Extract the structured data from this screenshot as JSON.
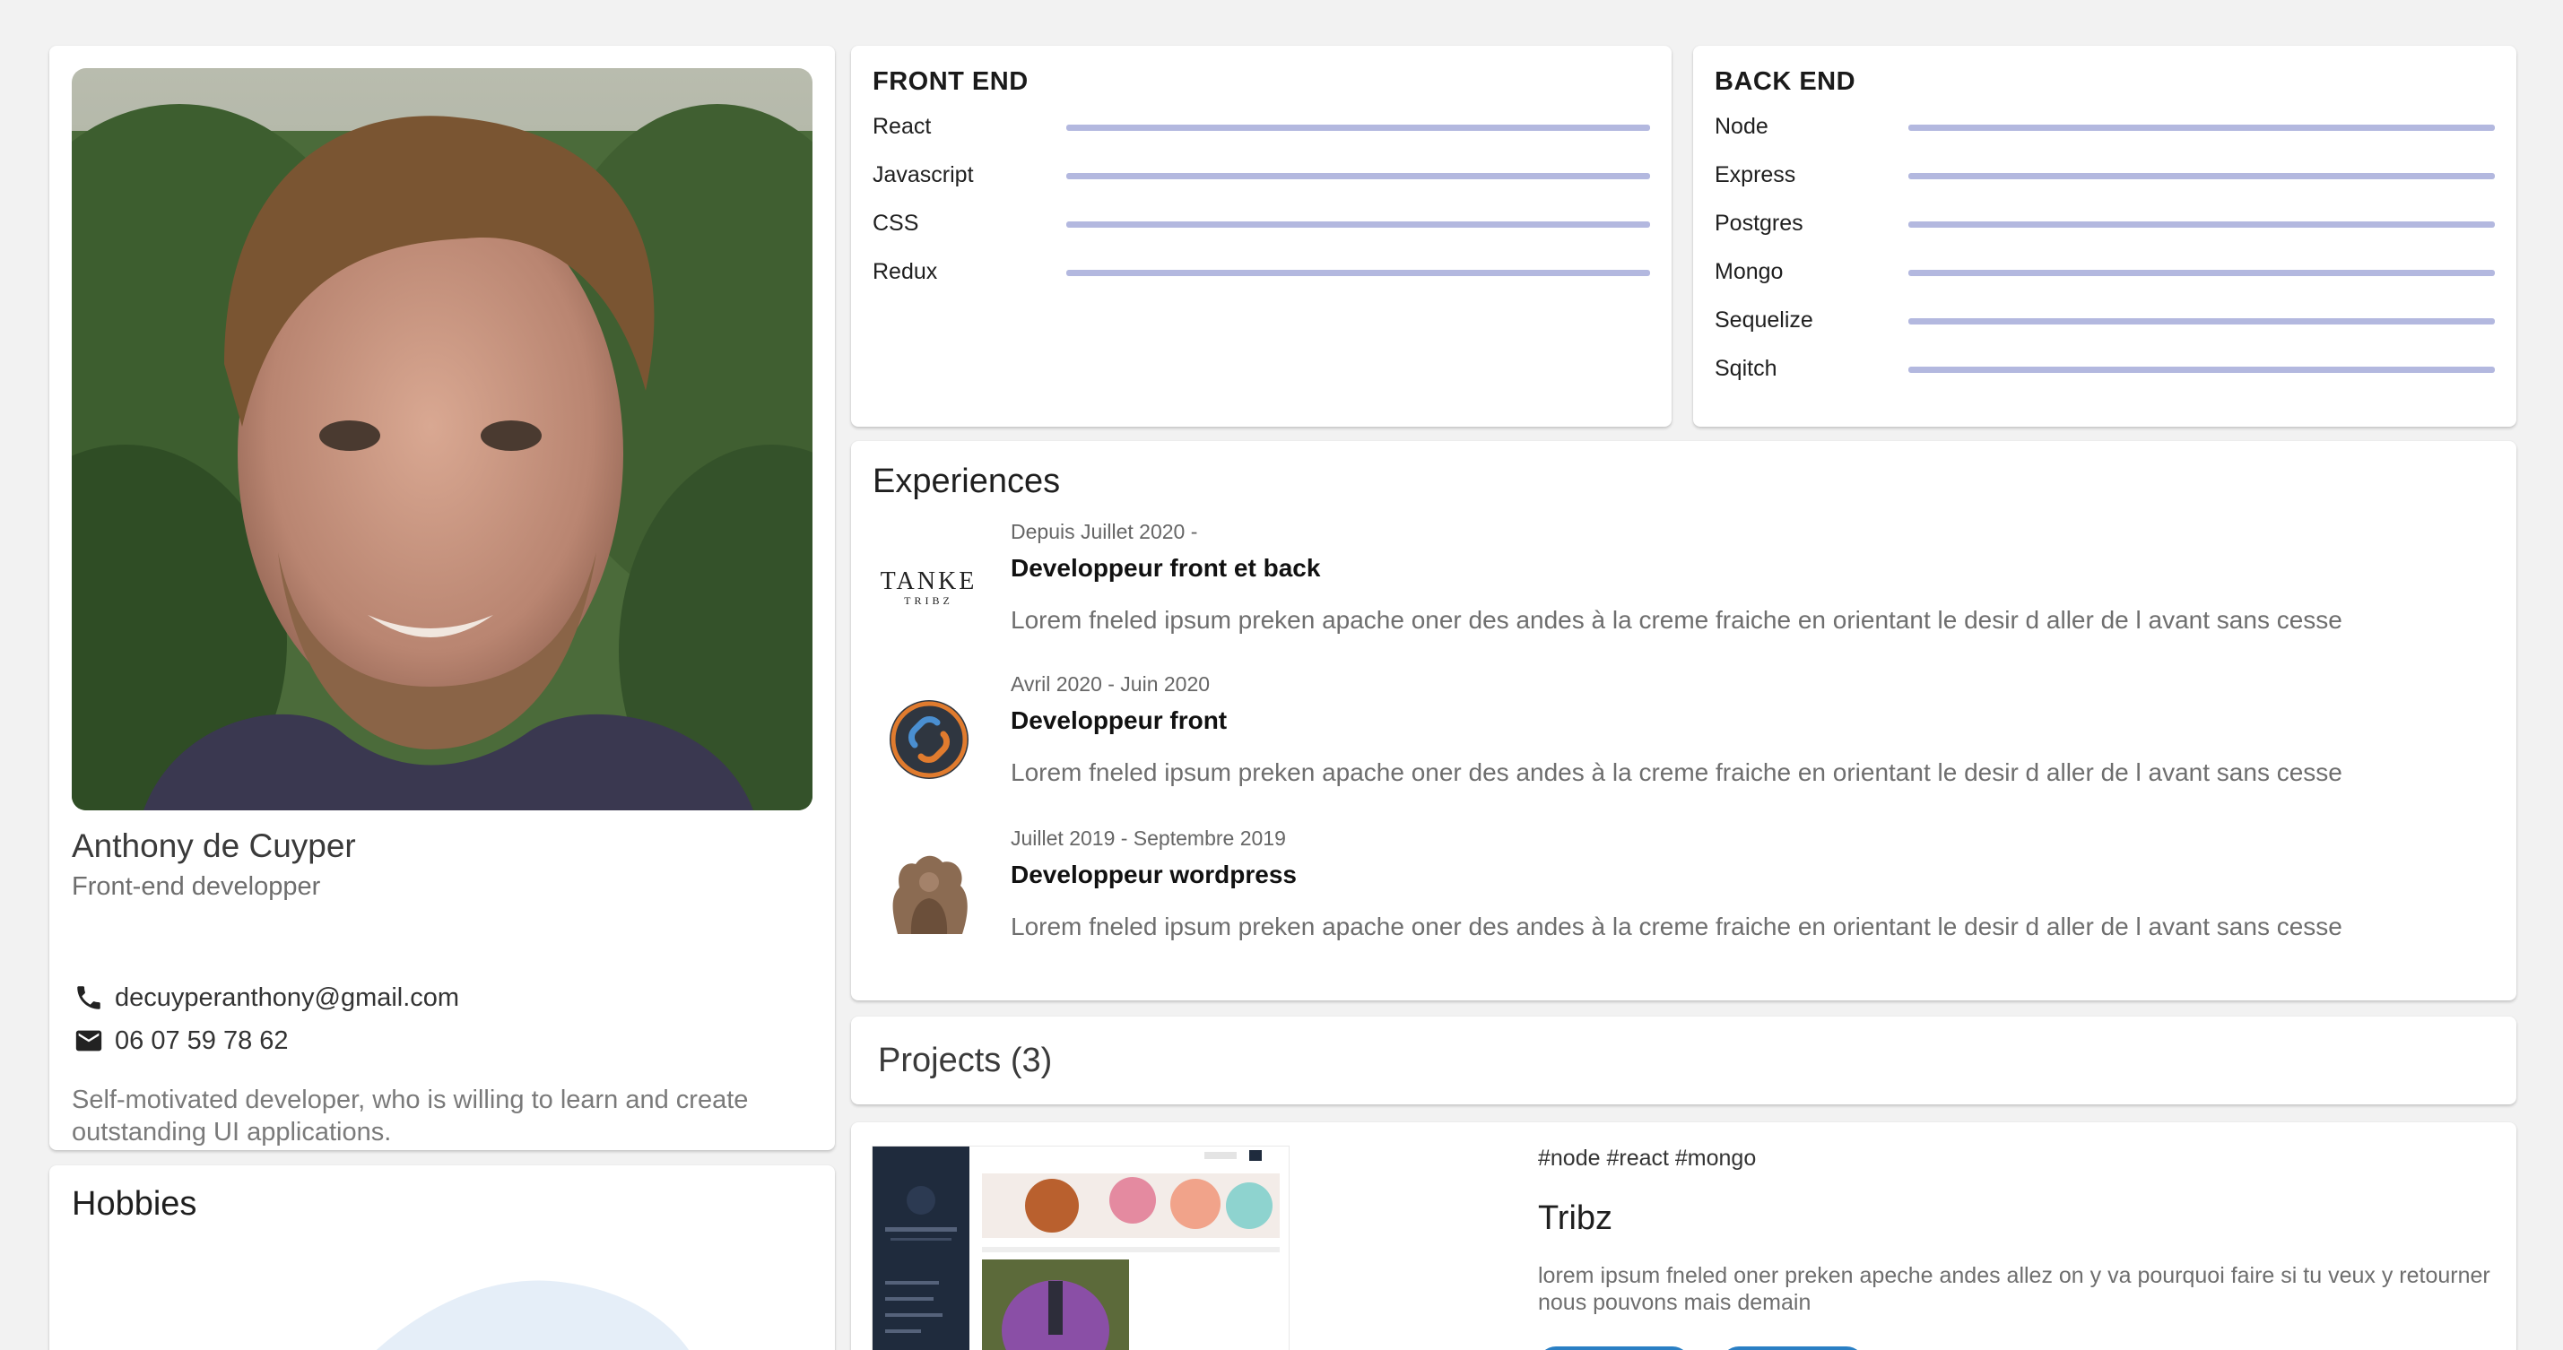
{
  "profile": {
    "name": "Anthony de Cuyper",
    "role": "Front-end developper",
    "email": "decuyperanthony@gmail.com",
    "phone": "06 07 59 78 62",
    "bio": "Self-motivated developer, who is willing to learn and create outstanding UI applications.",
    "email_icon": "phone-icon",
    "phone_icon": "mail-icon"
  },
  "hobbies": {
    "title": "Hobbies"
  },
  "frontend": {
    "title": "FRONT END",
    "skills": [
      {
        "name": "React",
        "level": 1.0
      },
      {
        "name": "Javascript",
        "level": 1.0
      },
      {
        "name": "CSS",
        "level": 1.0
      },
      {
        "name": "Redux",
        "level": 1.0
      }
    ]
  },
  "backend": {
    "title": "BACK END",
    "skills": [
      {
        "name": "Node",
        "level": 1.0
      },
      {
        "name": "Express",
        "level": 1.0
      },
      {
        "name": "Postgres",
        "level": 1.0
      },
      {
        "name": "Mongo",
        "level": 1.0
      },
      {
        "name": "Sequelize",
        "level": 1.0
      },
      {
        "name": "Sqitch",
        "level": 1.0
      }
    ]
  },
  "experiences": {
    "title": "Experiences",
    "items": [
      {
        "date": "Depuis Juillet 2020 -",
        "role": "Developpeur front et back",
        "desc": "Lorem fneled ipsum preken apache oner des andes à la creme fraiche en orientant le desir d aller de l avant sans cesse",
        "logo_text": "TANKE",
        "logo_sub": "TRIBZ"
      },
      {
        "date": "Avril 2020 - Juin 2020",
        "role": "Developpeur front",
        "desc": "Lorem fneled ipsum preken apache oner des andes à la creme fraiche en orientant le desir d aller de l avant sans cesse"
      },
      {
        "date": "Juillet 2019 - Septembre 2019",
        "role": "Developpeur wordpress",
        "desc": "Lorem fneled ipsum preken apache oner des andes à la creme fraiche en orientant le desir d aller de l avant sans cesse"
      }
    ]
  },
  "projects": {
    "title": "Projects (3)",
    "items": [
      {
        "tags": "#node #react #mongo",
        "name": "Tribz",
        "desc": "lorem ipsum fneled oner preken apeche andes allez on y va pourquoi faire si tu veux y retourner nous pouvons mais demain"
      }
    ]
  },
  "colors": {
    "skill_fill": "#b3b8df",
    "skill_track": "#e6e8f4",
    "button": "#2a7fc4"
  }
}
